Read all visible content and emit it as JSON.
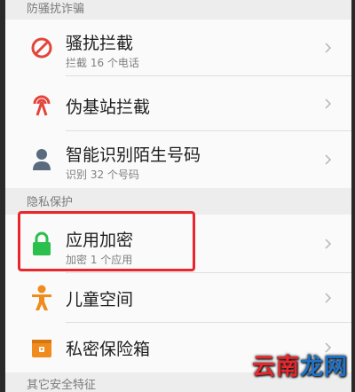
{
  "sections": {
    "harassment": "防骚扰诈骗",
    "privacy": "隐私保护",
    "other": "其它安全特征"
  },
  "rows": [
    {
      "title": "骚扰拦截",
      "sub": "拦截 16 个电话",
      "icon": "block-icon"
    },
    {
      "title": "伪基站拦截",
      "sub": "",
      "icon": "signal-tower-icon"
    },
    {
      "title": "智能识别陌生号码",
      "sub": "识别 32 个号码",
      "icon": "person-pin-icon"
    },
    {
      "title": "应用加密",
      "sub": "加密 1 个应用",
      "icon": "lock-icon"
    },
    {
      "title": "儿童空间",
      "sub": "",
      "icon": "child-icon"
    },
    {
      "title": "私密保险箱",
      "sub": "",
      "icon": "lockbox-icon"
    }
  ],
  "watermark": {
    "part1": "云南",
    "part2": "龙网"
  },
  "colors": {
    "block": "#e2453b",
    "signal": "#e2453b",
    "person": "#5a6b7d",
    "lock": "#2bbf4c",
    "child": "#f08c1d",
    "lockbox": "#f08c1d",
    "highlight": "#e8262b"
  }
}
